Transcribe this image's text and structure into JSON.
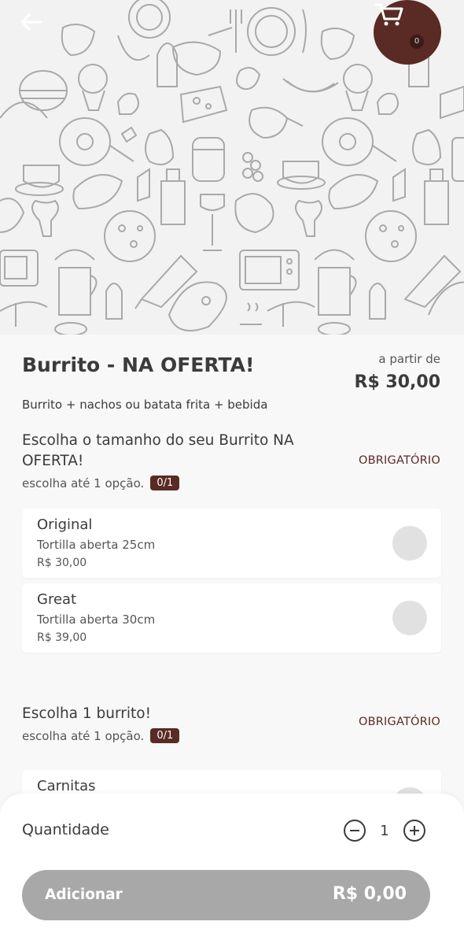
{
  "header": {
    "back_icon": "arrow-left-icon",
    "cart_icon": "cart-icon",
    "cart_count": "0",
    "hero_pattern": "food-doodle-pattern"
  },
  "product": {
    "title": "Burrito - NA OFERTA!",
    "from_label": "a partir de",
    "price": "R$ 30,00",
    "description": "Burrito + nachos ou batata frita + bebida"
  },
  "groups": [
    {
      "title": "Escolha o tamanho do seu Burrito NA OFERTA!",
      "required_label": "OBRIGATÓRIO",
      "choose_text": "escolha até 1 opção.",
      "counter": "0/1",
      "options": [
        {
          "name": "Original",
          "description": "Tortilla aberta 25cm",
          "price": "R$ 30,00"
        },
        {
          "name": "Great",
          "description": "Tortilla aberta 30cm",
          "price": "R$ 39,00"
        }
      ]
    },
    {
      "title": "Escolha 1 burrito!",
      "required_label": "OBRIGATÓRIO",
      "choose_text": "escolha até 1 opção.",
      "counter": "0/1",
      "options": [
        {
          "name": "Carnitas"
        }
      ]
    }
  ],
  "footer": {
    "quantity_label": "Quantidade",
    "quantity": "1",
    "add_label": "Adicionar",
    "add_price": "R$ 0,00"
  },
  "colors": {
    "brand": "#5a2a25",
    "button_disabled": "#a8a8a8",
    "radio": "#e1e1e1"
  }
}
